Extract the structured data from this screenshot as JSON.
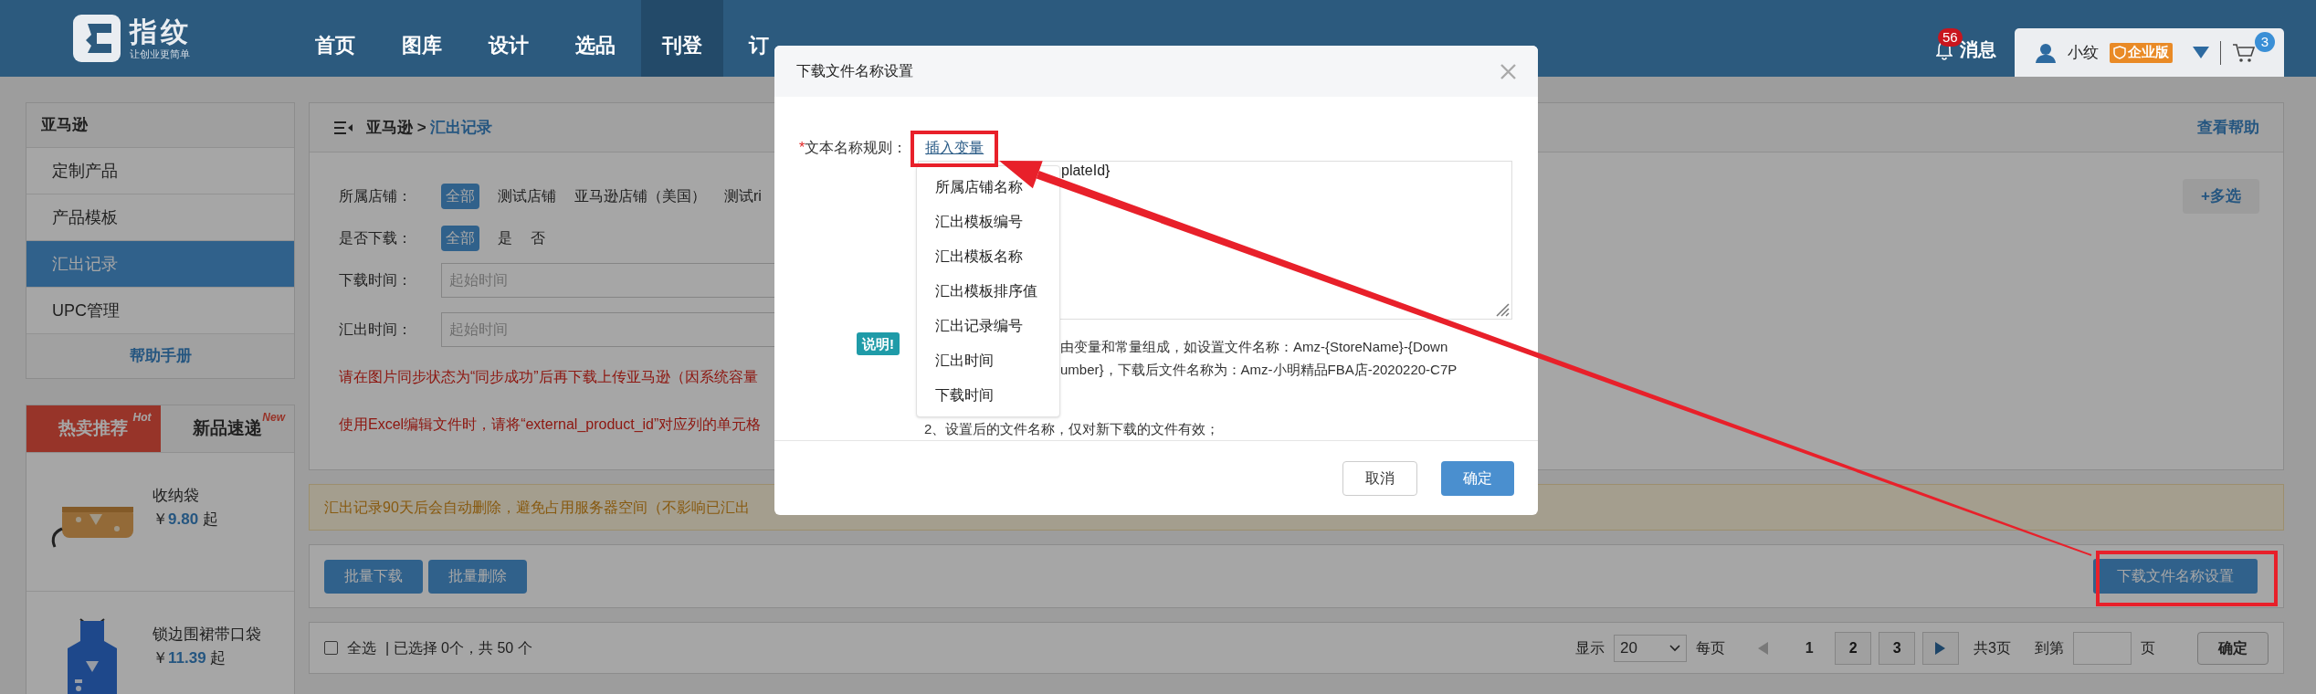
{
  "header": {
    "logo": {
      "name": "指纹",
      "tagline": "让创业更简单"
    },
    "nav": [
      {
        "label": "首页",
        "selected": false
      },
      {
        "label": "图库",
        "selected": false
      },
      {
        "label": "设计",
        "selected": false
      },
      {
        "label": "选品",
        "selected": false
      },
      {
        "label": "刊登",
        "selected": true
      },
      {
        "label": "订",
        "selected": false
      }
    ],
    "messages": {
      "label": "消息",
      "count": "56"
    },
    "user": {
      "name": "小纹",
      "edition": "企业版"
    },
    "cart": {
      "count": "3"
    }
  },
  "sidebar": {
    "title": "亚马逊",
    "items": [
      {
        "label": "定制产品",
        "selected": false
      },
      {
        "label": "产品模板",
        "selected": false
      },
      {
        "label": "汇出记录",
        "selected": true
      },
      {
        "label": "UPC管理",
        "selected": false
      }
    ],
    "help": "帮助手册"
  },
  "promo": {
    "tabs": [
      {
        "label": "热卖推荐",
        "tag": "Hot",
        "selected": true
      },
      {
        "label": "新品速递",
        "tag": "New",
        "selected": false
      }
    ],
    "products": [
      {
        "name": "收纳袋",
        "currency": "￥",
        "price": "9.80",
        "suffix": "起"
      },
      {
        "name": "锁边围裙带口袋",
        "currency": "￥",
        "price": "11.39",
        "suffix": "起"
      }
    ]
  },
  "main": {
    "breadcrumb": {
      "parent": "亚马逊",
      "separator": ">",
      "current": "汇出记录"
    },
    "help_link": "查看帮助",
    "filters": [
      {
        "label": "所属店铺：",
        "options": [
          {
            "label": "全部",
            "selected": true
          },
          {
            "label": "测试店铺",
            "selected": false
          },
          {
            "label": "亚马逊店铺（美国）",
            "selected": false
          },
          {
            "label": "测试ri",
            "selected": false
          }
        ]
      },
      {
        "label": "是否下载：",
        "options": [
          {
            "label": "全部",
            "selected": true
          },
          {
            "label": "是",
            "selected": false
          },
          {
            "label": "否",
            "selected": false
          }
        ]
      }
    ],
    "more_button": "+多选",
    "date_filters": [
      {
        "label": "下载时间：",
        "placeholder": "起始时间"
      },
      {
        "label": "汇出时间：",
        "placeholder": "起始时间"
      }
    ],
    "warnings": [
      "请在图片同步状态为“同步成功”后再下载上传亚马逊（因系统容量",
      "使用Excel编辑文件时，请将“external_product_id”对应列的单元格"
    ],
    "notice": "汇出记录90天后会自动删除，避免占用服务器空间（不影响已汇出",
    "actions": [
      "批量下载",
      "批量删除"
    ],
    "name_settings_button": "下载文件名称设置",
    "pagination": {
      "select_all": {
        "label": "全选",
        "checked": false
      },
      "summary": "| 已选择 0个，共 50 个",
      "show": "显示",
      "page_size": "20",
      "per_page": "每页",
      "prev": {
        "disabled": true
      },
      "pages": [
        {
          "label": "1",
          "selected": true
        },
        {
          "label": "2",
          "selected": false
        },
        {
          "label": "3",
          "selected": false
        }
      ],
      "next": {
        "disabled": false
      },
      "total": "共3页",
      "goto": "到第",
      "page_unit": "页",
      "confirm": "确定"
    }
  },
  "modal": {
    "title": "下载文件名称设置",
    "required_mark": "*",
    "field_label": "文本名称规则：",
    "insert_link": "插入变量",
    "textarea_value": "plateId}",
    "variables": [
      "所属店铺名称",
      "汇出模板编号",
      "汇出模板名称",
      "汇出模板排序值",
      "汇出记录编号",
      "汇出时间",
      "下载时间"
    ],
    "note_badge": "说明!",
    "note_lines": [
      "由变量和常量组成，如设置文件名称：Amz-{StoreName}-{Down",
      "umber}，下载后文件名称为：Amz-小明精品FBA店-2020220-C7P",
      "2、设置后的文件名称，仅对新下载的文件有效；"
    ],
    "buttons": {
      "cancel": "取消",
      "ok": "确定"
    }
  }
}
